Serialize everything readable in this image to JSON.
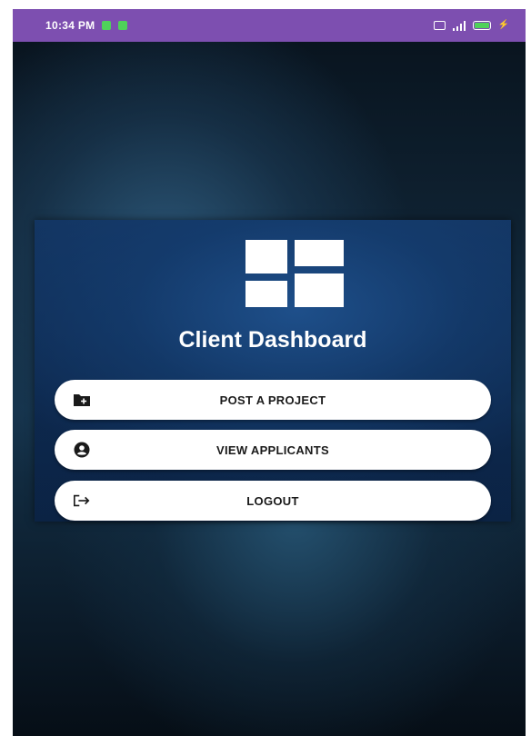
{
  "status_bar": {
    "time": "10:34 PM",
    "background_color": "#7d4fb0",
    "notification_dot_color": "#4fd15a",
    "icons": [
      "notification-icon",
      "notification-icon",
      "sim-icon",
      "signal-icon",
      "battery-icon",
      "charging-icon"
    ]
  },
  "dashboard": {
    "logo_icon": "dashboard-grid-icon",
    "title": "Client Dashboard",
    "buttons": [
      {
        "label": "POST A PROJECT",
        "icon": "folder-plus-icon"
      },
      {
        "label": "VIEW APPLICANTS",
        "icon": "account-circle-icon"
      },
      {
        "label": "LOGOUT",
        "icon": "logout-icon"
      }
    ]
  },
  "colors": {
    "card_background": "#153a6a",
    "button_background": "#ffffff",
    "button_text": "#1a1a1a",
    "title_text": "#ffffff"
  }
}
